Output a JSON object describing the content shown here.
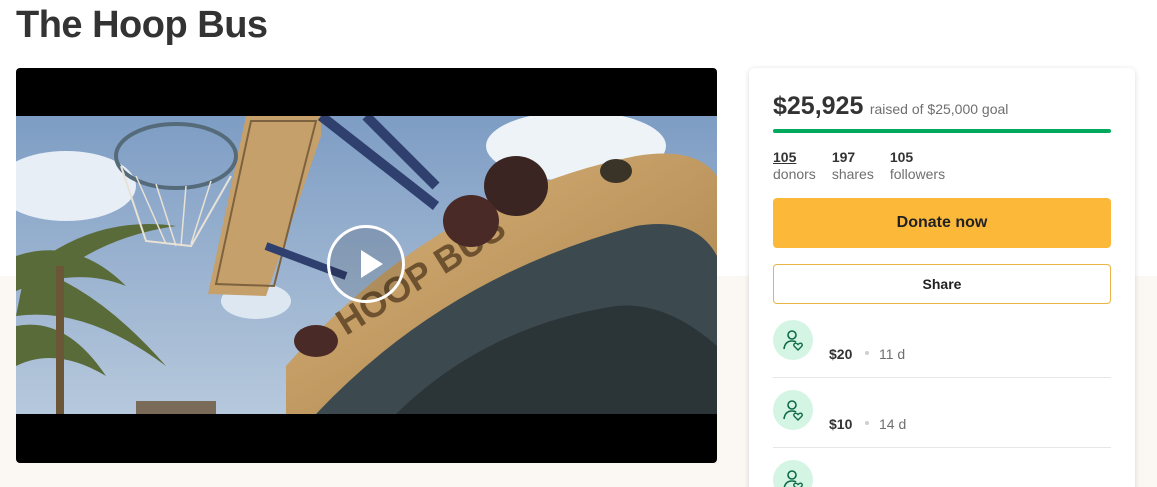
{
  "campaign": {
    "title": "The Hoop Bus"
  },
  "video": {
    "play_icon": "play-icon",
    "progress_display": "thumbnail"
  },
  "card": {
    "raised_amount": "$25,925",
    "goal_text": "raised of $25,000 goal",
    "progress_fraction": 1.0,
    "accent_color": "#02a95c",
    "stats": [
      {
        "number": "105",
        "label": "donors"
      },
      {
        "number": "197",
        "label": "shares"
      },
      {
        "number": "105",
        "label": "followers"
      }
    ],
    "donate_label": "Donate now",
    "donate_color": "#fbb839",
    "share_label": "Share",
    "donations": [
      {
        "amount": "$20",
        "time": "11 d",
        "icon": "donor-heart-icon"
      },
      {
        "amount": "$10",
        "time": "14 d",
        "icon": "donor-heart-icon"
      },
      {
        "amount": "",
        "time": "",
        "icon": "donor-heart-icon"
      }
    ]
  }
}
